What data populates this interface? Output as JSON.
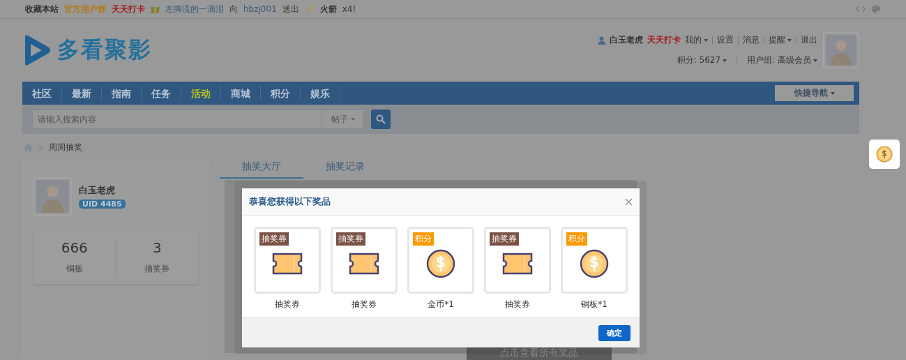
{
  "topbar": {
    "links": [
      {
        "text": "收藏本站",
        "color": "#333333"
      },
      {
        "text": "官方用户群",
        "color": "#b07a1a"
      },
      {
        "text": "天天打卡",
        "color": "#a01818"
      }
    ],
    "announcement": {
      "giver": "左脚流的一滴泪",
      "verb": "向",
      "receiver": "hbzj001",
      "action": "送出",
      "gift": "火箭",
      "count": "x4!"
    }
  },
  "logo": {
    "text": "多看聚影"
  },
  "user": {
    "name": "白玉老虎",
    "checkin": "天天打卡",
    "menu": [
      {
        "label": "我的",
        "dropdown": true
      },
      {
        "label": "设置",
        "dropdown": false
      },
      {
        "label": "消息",
        "dropdown": false
      },
      {
        "label": "提醒",
        "dropdown": true
      },
      {
        "label": "退出",
        "dropdown": false
      }
    ],
    "points": "积分: 5627",
    "group": "用户组: 高级会员"
  },
  "nav": {
    "items": [
      {
        "label": "社区",
        "selected": false
      },
      {
        "label": "最新",
        "selected": false
      },
      {
        "label": "指南",
        "selected": false
      },
      {
        "label": "任务",
        "selected": false
      },
      {
        "label": "活动",
        "selected": true
      },
      {
        "label": "商城",
        "selected": false
      },
      {
        "label": "积分",
        "selected": false
      },
      {
        "label": "娱乐",
        "selected": false
      }
    ],
    "quick_nav": "快捷导航"
  },
  "search": {
    "placeholder": "请输入搜索内容",
    "scope": "帖子"
  },
  "breadcrumb": [
    "周周抽奖"
  ],
  "profile": {
    "name": "白玉老虎",
    "uid": "UID 4485",
    "stats": [
      {
        "value": "666",
        "label": "铜板"
      },
      {
        "value": "3",
        "label": "抽奖券"
      }
    ]
  },
  "tabs": [
    {
      "label": "抽奖大厅",
      "selected": true
    },
    {
      "label": "抽奖记录",
      "selected": false
    }
  ],
  "view_all": "点击查看所有奖品",
  "modal": {
    "title": "恭喜您获得以下奖品",
    "prizes": [
      {
        "tag": "抽奖券",
        "color": "#7a5246",
        "kind": "ticket",
        "label": "抽奖券"
      },
      {
        "tag": "抽奖券",
        "color": "#7a5246",
        "kind": "ticket",
        "label": "抽奖券"
      },
      {
        "tag": "积分",
        "color": "#ff9900",
        "kind": "coin",
        "label": "金币*1"
      },
      {
        "tag": "抽奖券",
        "color": "#7a5246",
        "kind": "ticket",
        "label": "抽奖券"
      },
      {
        "tag": "积分",
        "color": "#ff9900",
        "kind": "coin",
        "label": "铜板*1"
      }
    ],
    "confirm": "确定"
  }
}
